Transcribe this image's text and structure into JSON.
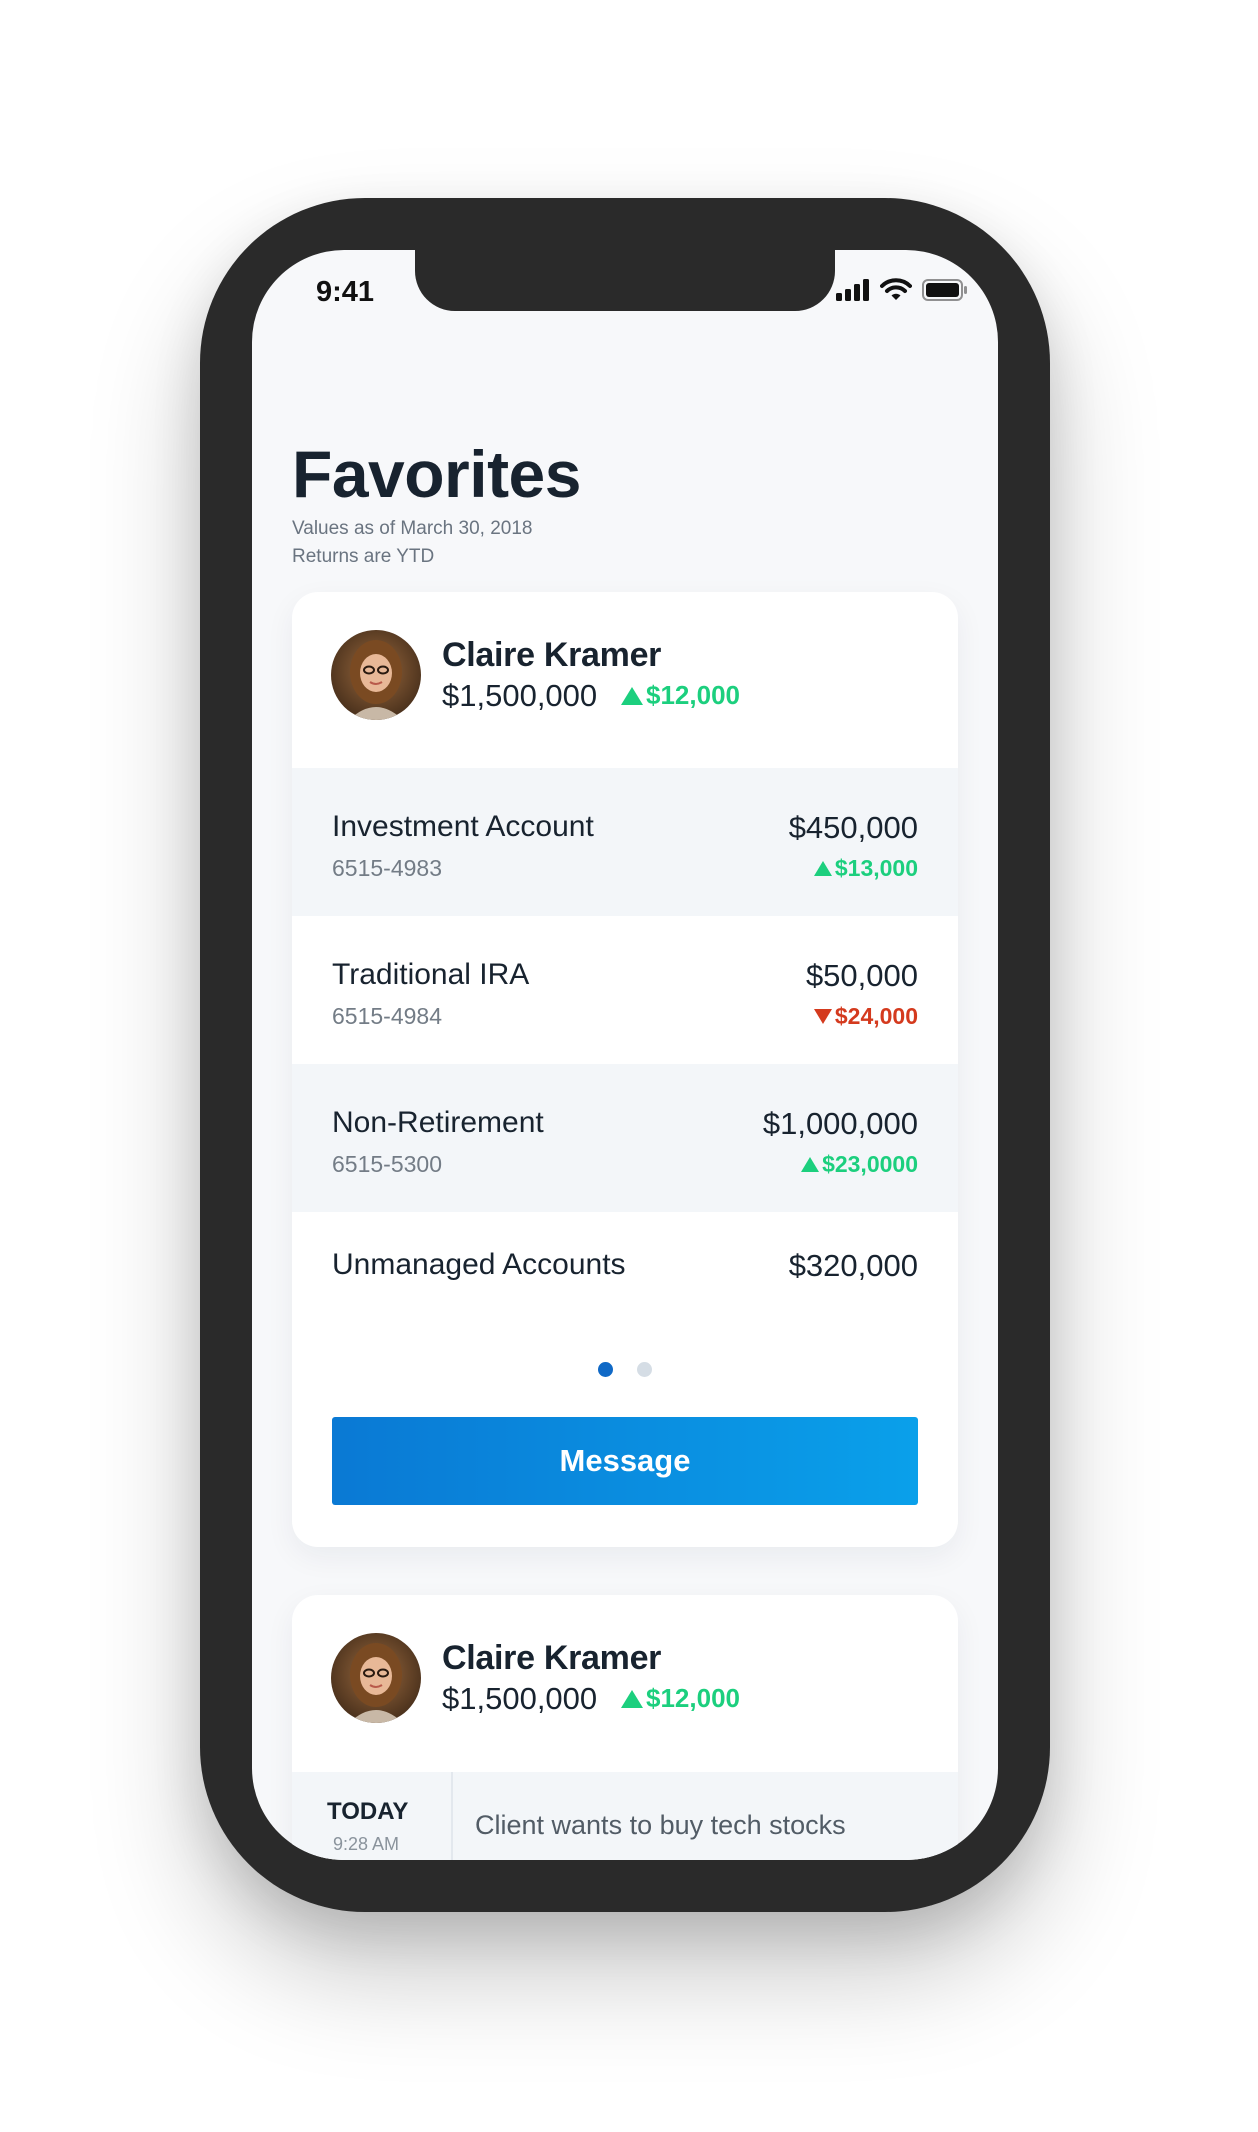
{
  "status_bar": {
    "time": "9:41",
    "icons": [
      "cellular-signal-icon",
      "wifi-icon",
      "battery-icon"
    ]
  },
  "page": {
    "title": "Favorites",
    "values_as_of": "Values as of March 30, 2018",
    "returns_note": "Returns are YTD"
  },
  "favorites": [
    {
      "client": {
        "name": "Claire Kramer",
        "total": "$1,500,000",
        "change": "$12,000",
        "change_direction": "up"
      },
      "accounts": [
        {
          "name": "Investment Account",
          "number": "6515-4983",
          "value": "$450,000",
          "change": "$13,000",
          "direction": "up"
        },
        {
          "name": "Traditional IRA",
          "number": "6515-4984",
          "value": "$50,000",
          "change": "$24,000",
          "direction": "down"
        },
        {
          "name": "Non-Retirement",
          "number": "6515-5300",
          "value": "$1,000,000",
          "change": "$23,0000",
          "direction": "up"
        },
        {
          "name": "Unmanaged Accounts",
          "value": "$320,000"
        }
      ],
      "pagination": {
        "current": 1,
        "total": 2
      },
      "message_label": "Message"
    },
    {
      "client": {
        "name": "Claire Kramer",
        "total": "$1,500,000",
        "change": "$12,000",
        "change_direction": "up"
      },
      "note": {
        "day": "TODAY",
        "time": "9:28 AM",
        "text": "Client wants to buy tech stocks"
      }
    }
  ],
  "colors": {
    "positive": "#1ccf7e",
    "negative": "#d43a1e",
    "accent": "#0a88dd",
    "text_primary": "#18232f"
  }
}
